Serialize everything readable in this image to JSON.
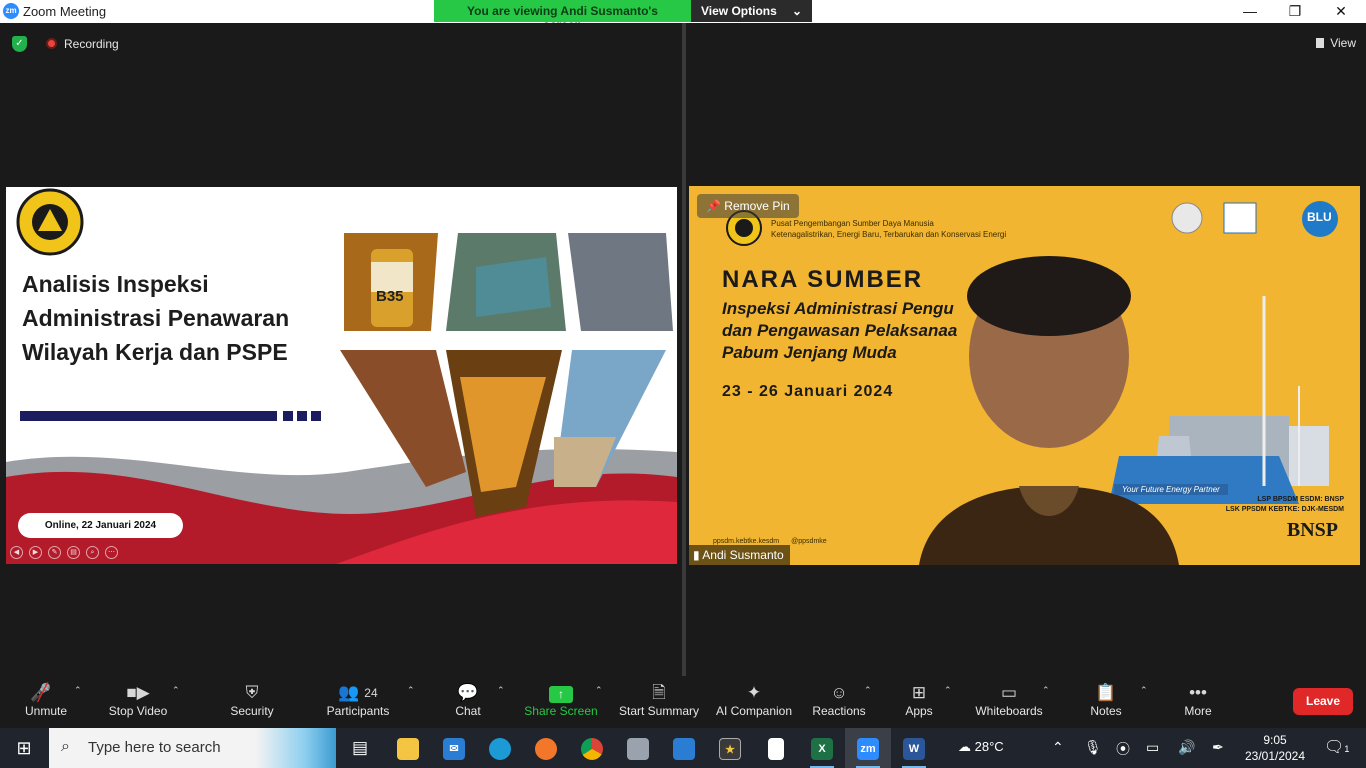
{
  "window": {
    "title": "Zoom Meeting",
    "controls": {
      "minimize": "—",
      "restore": "❐",
      "close": "✕"
    }
  },
  "share_banner": {
    "viewing": "You are viewing Andi Susmanto's screen",
    "options": "View Options"
  },
  "topbar": {
    "recording": "Recording",
    "view": "View"
  },
  "shared_slide": {
    "title_lines": [
      "Analisis Inspeksi",
      "Administrasi Penawaran",
      "Wilayah Kerja dan PSPE"
    ],
    "date_pill": "Online, 22 Januari 2024",
    "image_label": "B35"
  },
  "speaker_video": {
    "remove_pin": "Remove Pin",
    "org_line1": "Pusat Pengembangan Sumber Daya Manusia",
    "org_line2": "Ketenagalistrikan, Energi Baru, Terbarukan dan Konservasi Energi",
    "badge_blu": "BLU",
    "heading": "NARA SUMBER",
    "course_lines": [
      "Inspeksi Administrasi Pengu",
      "dan Pengawasan Pelaksanaa",
      "Pabum Jenjang Muda"
    ],
    "dates": "23 - 26 Januari 2024",
    "partner": "Your Future Energy Partner",
    "lsp_line1": "LSP BPSDM ESDM: BNSP",
    "lsp_line2": "LSK PPSDM KEBTKE: DJK-MESDM",
    "bnsp": "BNSP",
    "social_fb": "ppsdm.kebtke.kesdm",
    "social_tw": "@ppsdmke",
    "participant_name": "Andi Susmanto"
  },
  "toolbar": {
    "unmute": "Unmute",
    "stop_video": "Stop Video",
    "security": "Security",
    "participants": "Participants",
    "participants_count": "24",
    "chat": "Chat",
    "share_screen": "Share Screen",
    "start_summary": "Start Summary",
    "ai_companion": "AI Companion",
    "reactions": "Reactions",
    "apps": "Apps",
    "whiteboards": "Whiteboards",
    "notes": "Notes",
    "more": "More",
    "leave": "Leave"
  },
  "taskbar": {
    "search_placeholder": "Type here to search",
    "weather_temp": "28°C",
    "time": "9:05",
    "date": "23/01/2024",
    "notifications": "1"
  },
  "icons": {
    "security": "shield-icon",
    "recording": "record-dot-icon",
    "mic": "mic-muted-icon",
    "video": "camera-icon"
  },
  "colors": {
    "accent_green": "#26c846",
    "leave_red": "#e02828",
    "zoom_blue": "#2d8cff",
    "slide_red": "#b31b2b"
  }
}
